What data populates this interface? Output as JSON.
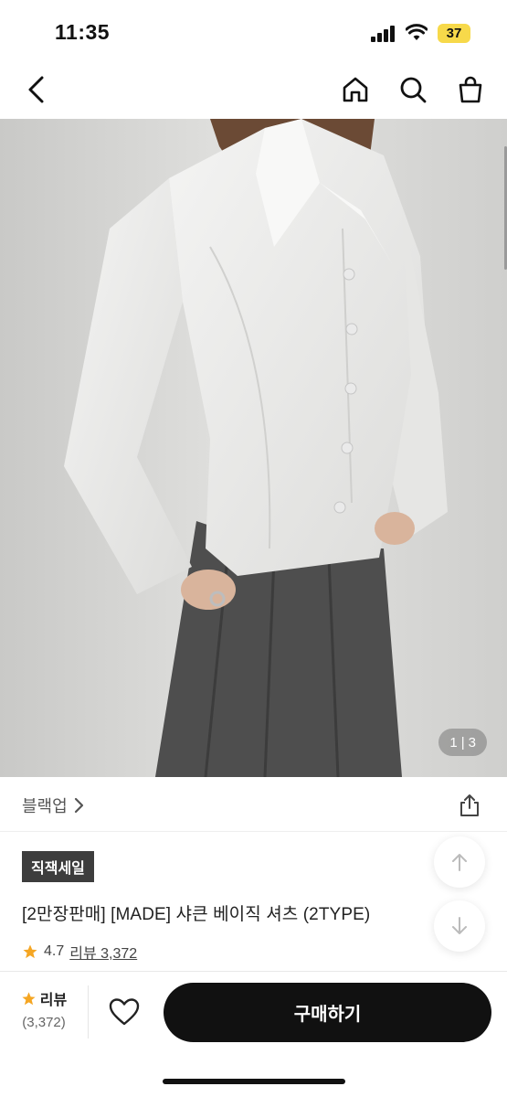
{
  "status_bar": {
    "time": "11:35",
    "battery": "37"
  },
  "nav": {
    "icons": [
      "back-icon",
      "home-icon",
      "search-icon",
      "bag-icon"
    ]
  },
  "gallery": {
    "current": "1",
    "separator": "|",
    "total": "3"
  },
  "brand": {
    "name": "블랙업"
  },
  "product": {
    "badge": "직잭세일",
    "title": "[2만장판매] [MADE] 샤큰 베이직 셔츠 (2TYPE)",
    "rating": "4.7",
    "review_link": "리뷰 3,372"
  },
  "bottom_bar": {
    "review_label": "리뷰",
    "review_count": "(3,372)",
    "buy_label": "구매하기"
  },
  "colors": {
    "accent": "#111111",
    "star": "#f5a623",
    "badge_bg": "#3d3d3d",
    "battery": "#f7d94a"
  }
}
